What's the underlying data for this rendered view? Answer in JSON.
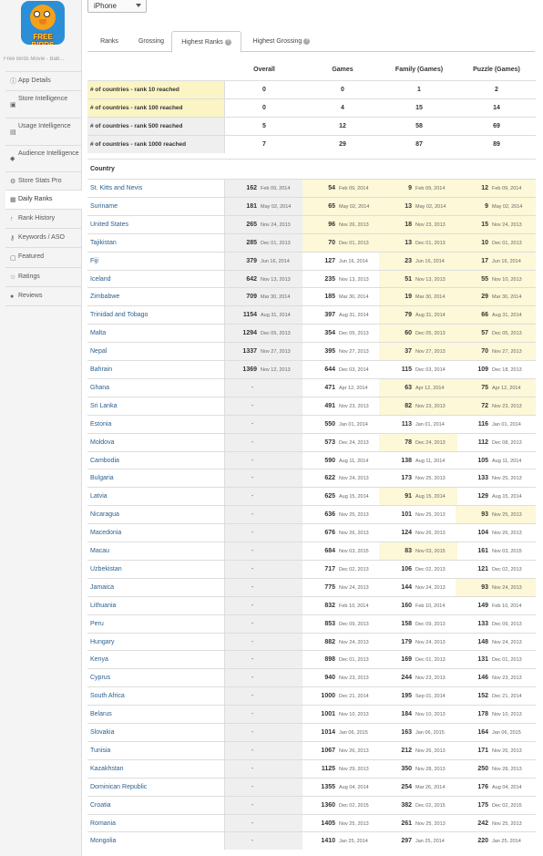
{
  "app": {
    "icon_text": "FREE BIRDS",
    "name": "Free Birds Movie - Bab..."
  },
  "sidebar": {
    "items": [
      {
        "label": "App Details",
        "icon": "info-icon"
      },
      {
        "label": "Store Intelligence",
        "icon": "store-icon"
      },
      {
        "label": "Usage Intelligence",
        "icon": "usage-icon"
      },
      {
        "label": "Audience Intelligence",
        "icon": "audience-icon"
      },
      {
        "label": "Store Stats Pro",
        "icon": "stats-icon"
      },
      {
        "label": "Daily Ranks",
        "icon": "calendar-icon"
      },
      {
        "label": "Rank History",
        "icon": "arrow-up-icon"
      },
      {
        "label": "Keywords / ASO",
        "icon": "key-icon"
      },
      {
        "label": "Featured",
        "icon": "featured-icon"
      },
      {
        "label": "Ratings",
        "icon": "star-icon"
      },
      {
        "label": "Reviews",
        "icon": "chat-icon"
      }
    ],
    "active": "Daily Ranks"
  },
  "device_select": {
    "value": "iPhone"
  },
  "tabs": [
    {
      "label": "Ranks"
    },
    {
      "label": "Grossing"
    },
    {
      "label": "Highest Ranks",
      "active": true,
      "help": "?"
    },
    {
      "label": "Highest Grossing",
      "help": "?"
    }
  ],
  "table": {
    "columns": [
      "Overall",
      "Games",
      "Family (Games)",
      "Puzzle (Games)"
    ],
    "summary": [
      {
        "label": "# of countries - rank 10 reached",
        "values": [
          "0",
          "0",
          "1",
          "2"
        ]
      },
      {
        "label": "# of countries - rank 100 reached",
        "values": [
          "0",
          "4",
          "15",
          "14"
        ]
      },
      {
        "label": "# of countries - rank 500 reached",
        "values": [
          "5",
          "12",
          "58",
          "69"
        ]
      },
      {
        "label": "# of countries - rank 1000 reached",
        "values": [
          "7",
          "29",
          "87",
          "89"
        ]
      }
    ],
    "country_header": "Country",
    "rows": [
      {
        "country": "St. Kitts and Nevis",
        "overall": [
          "162",
          "Feb 09, 2014"
        ],
        "games": [
          "54",
          "Feb 09, 2014"
        ],
        "family": [
          "9",
          "Feb 09, 2014"
        ],
        "puzzle": [
          "12",
          "Feb 09, 2014"
        ]
      },
      {
        "country": "Suriname",
        "overall": [
          "181",
          "May 02, 2014"
        ],
        "games": [
          "65",
          "May 02, 2014"
        ],
        "family": [
          "13",
          "May 02, 2014"
        ],
        "puzzle": [
          "9",
          "May 02, 2014"
        ]
      },
      {
        "country": "United States",
        "overall": [
          "265",
          "Nov 24, 2013"
        ],
        "games": [
          "96",
          "Nov 26, 2013"
        ],
        "family": [
          "18",
          "Nov 23, 2013"
        ],
        "puzzle": [
          "15",
          "Nov 24, 2013"
        ]
      },
      {
        "country": "Tajikistan",
        "overall": [
          "285",
          "Dec 01, 2013"
        ],
        "games": [
          "70",
          "Dec 01, 2013"
        ],
        "family": [
          "13",
          "Dec 01, 2013"
        ],
        "puzzle": [
          "10",
          "Dec 01, 2013"
        ]
      },
      {
        "country": "Fiji",
        "overall": [
          "379",
          "Jun 16, 2014"
        ],
        "games": [
          "127",
          "Jun 16, 2014"
        ],
        "family": [
          "23",
          "Jun 16, 2014"
        ],
        "puzzle": [
          "17",
          "Jun 16, 2014"
        ]
      },
      {
        "country": "Iceland",
        "overall": [
          "642",
          "Nov 13, 2013"
        ],
        "games": [
          "235",
          "Nov 13, 2013"
        ],
        "family": [
          "51",
          "Nov 13, 2013"
        ],
        "puzzle": [
          "55",
          "Nov 10, 2013"
        ]
      },
      {
        "country": "Zimbabwe",
        "overall": [
          "709",
          "Mar 30, 2014"
        ],
        "games": [
          "185",
          "Mar 30, 2014"
        ],
        "family": [
          "19",
          "Mar 30, 2014"
        ],
        "puzzle": [
          "29",
          "Mar 30, 2014"
        ]
      },
      {
        "country": "Trinidad and Tobago",
        "overall": [
          "1154",
          "Aug 31, 2014"
        ],
        "games": [
          "397",
          "Aug 31, 2014"
        ],
        "family": [
          "79",
          "Aug 31, 2014"
        ],
        "puzzle": [
          "66",
          "Aug 31, 2014"
        ]
      },
      {
        "country": "Malta",
        "overall": [
          "1294",
          "Dec 05, 2013"
        ],
        "games": [
          "354",
          "Dec 05, 2013"
        ],
        "family": [
          "60",
          "Dec 05, 2013"
        ],
        "puzzle": [
          "57",
          "Dec 05, 2013"
        ]
      },
      {
        "country": "Nepal",
        "overall": [
          "1337",
          "Nov 27, 2013"
        ],
        "games": [
          "395",
          "Nov 27, 2013"
        ],
        "family": [
          "37",
          "Nov 27, 2013"
        ],
        "puzzle": [
          "70",
          "Nov 27, 2013"
        ]
      },
      {
        "country": "Bahrain",
        "overall": [
          "1369",
          "Nov 12, 2013"
        ],
        "games": [
          "644",
          "Dec 03, 2014"
        ],
        "family": [
          "115",
          "Dec 03, 2014"
        ],
        "puzzle": [
          "109",
          "Dec 18, 2013"
        ]
      },
      {
        "country": "Ghana",
        "overall": [
          "-",
          ""
        ],
        "games": [
          "471",
          "Apr 12, 2014"
        ],
        "family": [
          "63",
          "Apr 12, 2014"
        ],
        "puzzle": [
          "75",
          "Apr 12, 2014"
        ]
      },
      {
        "country": "Sri Lanka",
        "overall": [
          "-",
          ""
        ],
        "games": [
          "491",
          "Nov 23, 2013"
        ],
        "family": [
          "82",
          "Nov 23, 2013"
        ],
        "puzzle": [
          "72",
          "Nov 23, 2013"
        ]
      },
      {
        "country": "Estonia",
        "overall": [
          "-",
          ""
        ],
        "games": [
          "550",
          "Jan 01, 2014"
        ],
        "family": [
          "113",
          "Jan 01, 2014"
        ],
        "puzzle": [
          "116",
          "Jan 01, 2014"
        ]
      },
      {
        "country": "Moldova",
        "overall": [
          "-",
          ""
        ],
        "games": [
          "573",
          "Dec 24, 2013"
        ],
        "family": [
          "78",
          "Dec 24, 2013"
        ],
        "puzzle": [
          "112",
          "Dec 08, 2013"
        ]
      },
      {
        "country": "Cambodia",
        "overall": [
          "-",
          ""
        ],
        "games": [
          "590",
          "Aug 11, 2014"
        ],
        "family": [
          "138",
          "Aug 11, 2014"
        ],
        "puzzle": [
          "105",
          "Aug 11, 2014"
        ]
      },
      {
        "country": "Bulgaria",
        "overall": [
          "-",
          ""
        ],
        "games": [
          "622",
          "Nov 24, 2013"
        ],
        "family": [
          "173",
          "Nov 25, 2013"
        ],
        "puzzle": [
          "133",
          "Nov 25, 2013"
        ]
      },
      {
        "country": "Latvia",
        "overall": [
          "-",
          ""
        ],
        "games": [
          "625",
          "Aug 15, 2014"
        ],
        "family": [
          "91",
          "Aug 15, 2014"
        ],
        "puzzle": [
          "129",
          "Aug 15, 2014"
        ]
      },
      {
        "country": "Nicaragua",
        "overall": [
          "-",
          ""
        ],
        "games": [
          "636",
          "Nov 25, 2013"
        ],
        "family": [
          "101",
          "Nov 25, 2013"
        ],
        "puzzle": [
          "93",
          "Nov 25, 2013"
        ]
      },
      {
        "country": "Macedonia",
        "overall": [
          "-",
          ""
        ],
        "games": [
          "676",
          "Nov 26, 2013"
        ],
        "family": [
          "124",
          "Nov 26, 2013"
        ],
        "puzzle": [
          "104",
          "Nov 26, 2013"
        ]
      },
      {
        "country": "Macau",
        "overall": [
          "-",
          ""
        ],
        "games": [
          "684",
          "Nov 03, 2015"
        ],
        "family": [
          "83",
          "Nov 03, 2015"
        ],
        "puzzle": [
          "161",
          "Nov 03, 2015"
        ]
      },
      {
        "country": "Uzbekistan",
        "overall": [
          "-",
          ""
        ],
        "games": [
          "717",
          "Dec 02, 2013"
        ],
        "family": [
          "106",
          "Dec 02, 2013"
        ],
        "puzzle": [
          "121",
          "Dec 02, 2013"
        ]
      },
      {
        "country": "Jamaica",
        "overall": [
          "-",
          ""
        ],
        "games": [
          "775",
          "Nov 24, 2013"
        ],
        "family": [
          "144",
          "Nov 24, 2013"
        ],
        "puzzle": [
          "93",
          "Nov 24, 2013"
        ]
      },
      {
        "country": "Lithuania",
        "overall": [
          "-",
          ""
        ],
        "games": [
          "832",
          "Feb 10, 2014"
        ],
        "family": [
          "160",
          "Feb 10, 2014"
        ],
        "puzzle": [
          "149",
          "Feb 10, 2014"
        ]
      },
      {
        "country": "Peru",
        "overall": [
          "-",
          ""
        ],
        "games": [
          "853",
          "Dec 09, 2013"
        ],
        "family": [
          "158",
          "Dec 09, 2013"
        ],
        "puzzle": [
          "133",
          "Dec 09, 2013"
        ]
      },
      {
        "country": "Hungary",
        "overall": [
          "-",
          ""
        ],
        "games": [
          "882",
          "Nov 24, 2013"
        ],
        "family": [
          "179",
          "Nov 24, 2013"
        ],
        "puzzle": [
          "148",
          "Nov 24, 2013"
        ]
      },
      {
        "country": "Kenya",
        "overall": [
          "-",
          ""
        ],
        "games": [
          "898",
          "Dec 01, 2013"
        ],
        "family": [
          "169",
          "Dec 01, 2013"
        ],
        "puzzle": [
          "131",
          "Dec 01, 2013"
        ]
      },
      {
        "country": "Cyprus",
        "overall": [
          "-",
          ""
        ],
        "games": [
          "940",
          "Nov 23, 2013"
        ],
        "family": [
          "244",
          "Nov 23, 2013"
        ],
        "puzzle": [
          "146",
          "Nov 23, 2013"
        ]
      },
      {
        "country": "South Africa",
        "overall": [
          "-",
          ""
        ],
        "games": [
          "1000",
          "Dec 21, 2014"
        ],
        "family": [
          "195",
          "Sep 01, 2014"
        ],
        "puzzle": [
          "152",
          "Dec 21, 2014"
        ]
      },
      {
        "country": "Belarus",
        "overall": [
          "-",
          ""
        ],
        "games": [
          "1001",
          "Nov 10, 2013"
        ],
        "family": [
          "184",
          "Nov 10, 2013"
        ],
        "puzzle": [
          "178",
          "Nov 10, 2013"
        ]
      },
      {
        "country": "Slovakia",
        "overall": [
          "-",
          ""
        ],
        "games": [
          "1014",
          "Jan 06, 2015"
        ],
        "family": [
          "163",
          "Jan 06, 2015"
        ],
        "puzzle": [
          "164",
          "Jan 06, 2015"
        ]
      },
      {
        "country": "Tunisia",
        "overall": [
          "-",
          ""
        ],
        "games": [
          "1067",
          "Nov 26, 2013"
        ],
        "family": [
          "212",
          "Nov 26, 2013"
        ],
        "puzzle": [
          "171",
          "Nov 26, 2013"
        ]
      },
      {
        "country": "Kazakhstan",
        "overall": [
          "-",
          ""
        ],
        "games": [
          "1125",
          "Nov 29, 2013"
        ],
        "family": [
          "350",
          "Nov 28, 2013"
        ],
        "puzzle": [
          "250",
          "Nov 28, 2013"
        ]
      },
      {
        "country": "Dominican Republic",
        "overall": [
          "-",
          ""
        ],
        "games": [
          "1355",
          "Aug 04, 2014"
        ],
        "family": [
          "254",
          "Mar 26, 2014"
        ],
        "puzzle": [
          "176",
          "Aug 04, 2014"
        ]
      },
      {
        "country": "Croatia",
        "overall": [
          "-",
          ""
        ],
        "games": [
          "1360",
          "Dec 02, 2015"
        ],
        "family": [
          "382",
          "Dec 02, 2015"
        ],
        "puzzle": [
          "175",
          "Dec 02, 2015"
        ]
      },
      {
        "country": "Romania",
        "overall": [
          "-",
          ""
        ],
        "games": [
          "1405",
          "Nov 25, 2013"
        ],
        "family": [
          "261",
          "Nov 25, 2013"
        ],
        "puzzle": [
          "242",
          "Nov 25, 2013"
        ]
      },
      {
        "country": "Mongolia",
        "overall": [
          "-",
          ""
        ],
        "games": [
          "1410",
          "Jan 25, 2014"
        ],
        "family": [
          "297",
          "Jan 25, 2014"
        ],
        "puzzle": [
          "220",
          "Jan 25, 2014"
        ]
      }
    ]
  },
  "colors": {
    "highlight": "#fcf8d8",
    "summary_highlight": "#fbf4c4",
    "shade": "#efefef",
    "link": "#2b5f8f"
  }
}
